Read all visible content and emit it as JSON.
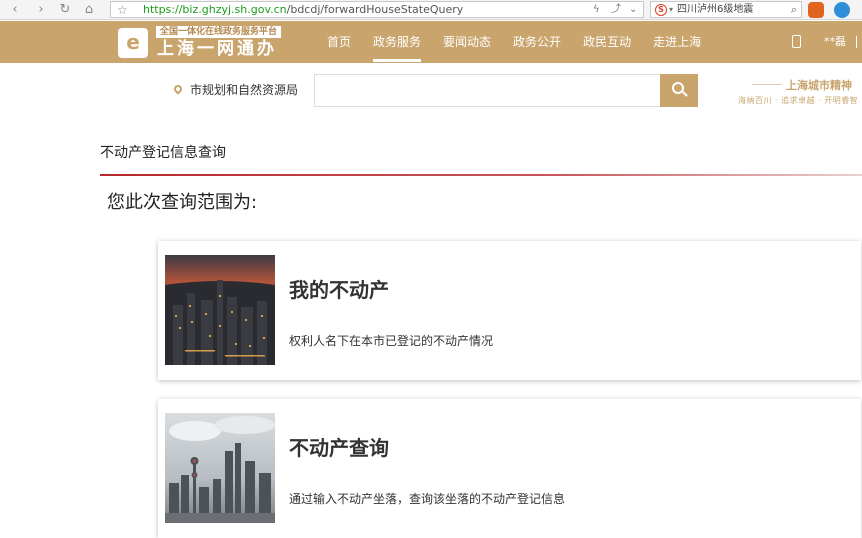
{
  "browser": {
    "url_host": "https://biz.ghzyj.sh.gov.cn",
    "url_path": "/bdcdj/forwardHouseStateQuery",
    "search_text": "四川泸州6级地震"
  },
  "header": {
    "logo_tag": "全国一体化在线政务服务平台",
    "logo_title": "上海一网通办",
    "nav": [
      {
        "label": "首页"
      },
      {
        "label": "政务服务"
      },
      {
        "label": "要闻动态"
      },
      {
        "label": "政务公开"
      },
      {
        "label": "政民互动"
      },
      {
        "label": "走进上海"
      }
    ],
    "user": "**磊"
  },
  "search": {
    "location": "市规划和自然资源局",
    "placeholder": "",
    "slogan_title": "上海城市精神",
    "slogan_sub": "海纳百川 · 追求卓越 · 开明睿智"
  },
  "content": {
    "section_title": "不动产登记信息查询",
    "range_title": "您此次查询范围为:",
    "cards": [
      {
        "title": "我的不动产",
        "desc": "权利人名下在本市已登记的不动产情况"
      },
      {
        "title": "不动产查询",
        "desc": "通过输入不动产坐落，查询该坐落的不动产登记信息"
      }
    ]
  },
  "colors": {
    "brand": "#c9a46c",
    "accent_line": "#b8272d"
  }
}
